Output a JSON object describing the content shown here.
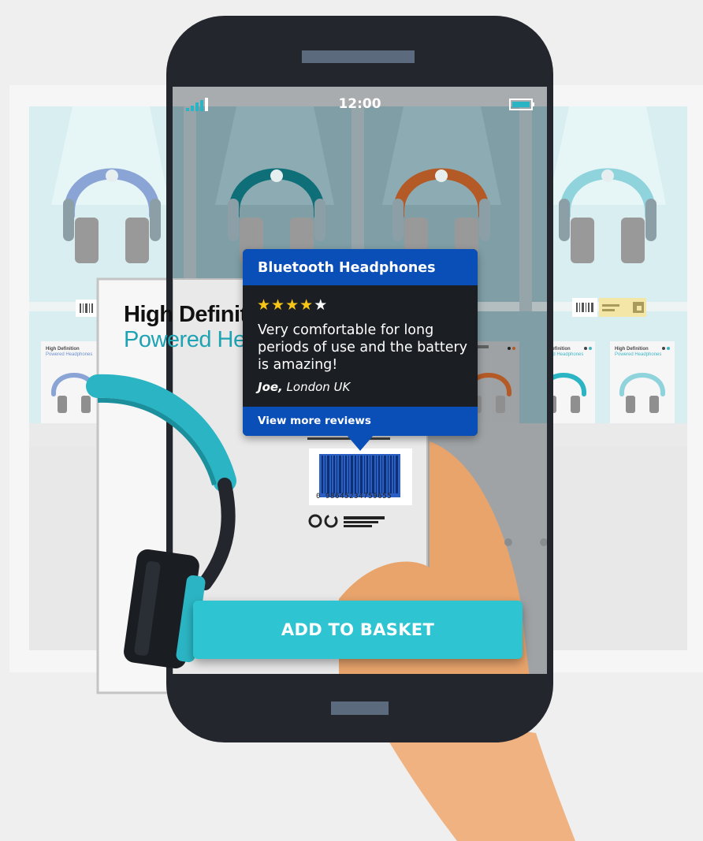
{
  "status_bar": {
    "time": "12:00",
    "signal_icon": "signal-bars-icon",
    "battery_icon": "battery-icon"
  },
  "product_popup": {
    "title": "Bluetooth Headphones",
    "rating": 4,
    "rating_max": 5,
    "review_text": "Very comfortable for long periods of use and the battery is amazing!",
    "review_author": "Joe,",
    "review_location": "London UK",
    "more_reviews_label": "View more reviews"
  },
  "product_box": {
    "title_line1": "High Definition",
    "title_line2": "Powered Headphones",
    "barcode_number": "0 98645234759655"
  },
  "shelf_box": {
    "title_line1": "High Definition",
    "title_line2": "Powered Headphones"
  },
  "actions": {
    "add_to_basket_label": "ADD TO BASKET"
  },
  "colors": {
    "accent": "#2ec4d2",
    "popup_blue": "#0a4fb8",
    "popup_dark": "#1b1e22",
    "star_filled": "#f5c518",
    "star_empty": "#ffffff",
    "phone_body": "#23272d",
    "box_teal": "#1fa3b3"
  }
}
